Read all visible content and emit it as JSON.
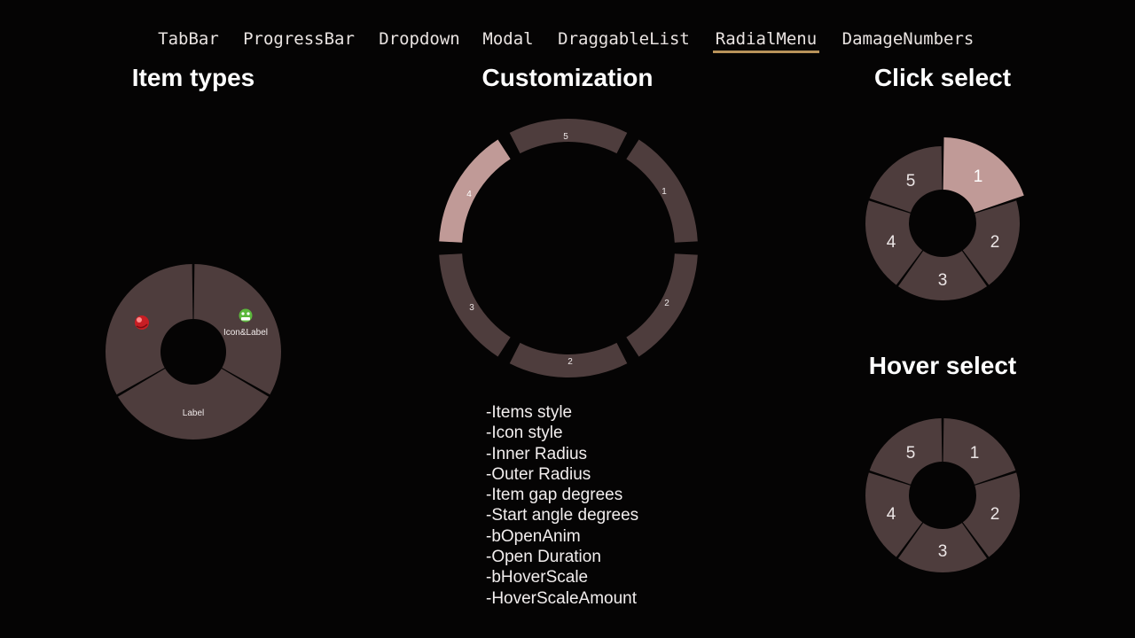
{
  "tabs": [
    {
      "label": "TabBar",
      "active": false
    },
    {
      "label": "ProgressBar",
      "active": false
    },
    {
      "label": "Dropdown",
      "active": false
    },
    {
      "label": "Modal",
      "active": false
    },
    {
      "label": "DraggableList",
      "active": false
    },
    {
      "label": "RadialMenu",
      "active": true
    },
    {
      "label": "DamageNumbers",
      "active": false
    }
  ],
  "sections": {
    "item_types": {
      "title": "Item types",
      "items": [
        {
          "kind": "icon",
          "icon": "red-orb-icon",
          "label": ""
        },
        {
          "kind": "icon-and-label",
          "icon": "green-face-icon",
          "label": "Icon&Label"
        },
        {
          "kind": "label",
          "label": "Label"
        }
      ]
    },
    "customization": {
      "title": "Customization",
      "items": [
        "1",
        "2",
        "2",
        "3",
        "4",
        "5"
      ],
      "highlighted": "4",
      "properties": [
        "-Items style",
        "-Icon style",
        "-Inner Radius",
        "-Outer Radius",
        "-Item gap degrees",
        "-Start angle degrees",
        "-bOpenAnim",
        "-Open Duration",
        "-bHoverScale",
        "-HoverScaleAmount"
      ]
    },
    "click_select": {
      "title": "Click select",
      "items": [
        "1",
        "2",
        "3",
        "4",
        "5"
      ],
      "selected": "1"
    },
    "hover_select": {
      "title": "Hover select",
      "items": [
        "1",
        "2",
        "3",
        "4",
        "5"
      ],
      "selected": ""
    }
  },
  "colors": {
    "segment": "#4e3d3d",
    "segment_highlight": "#c09a97",
    "separator": "#050404",
    "tab_underline": "#b9935a",
    "background": "#050404"
  }
}
